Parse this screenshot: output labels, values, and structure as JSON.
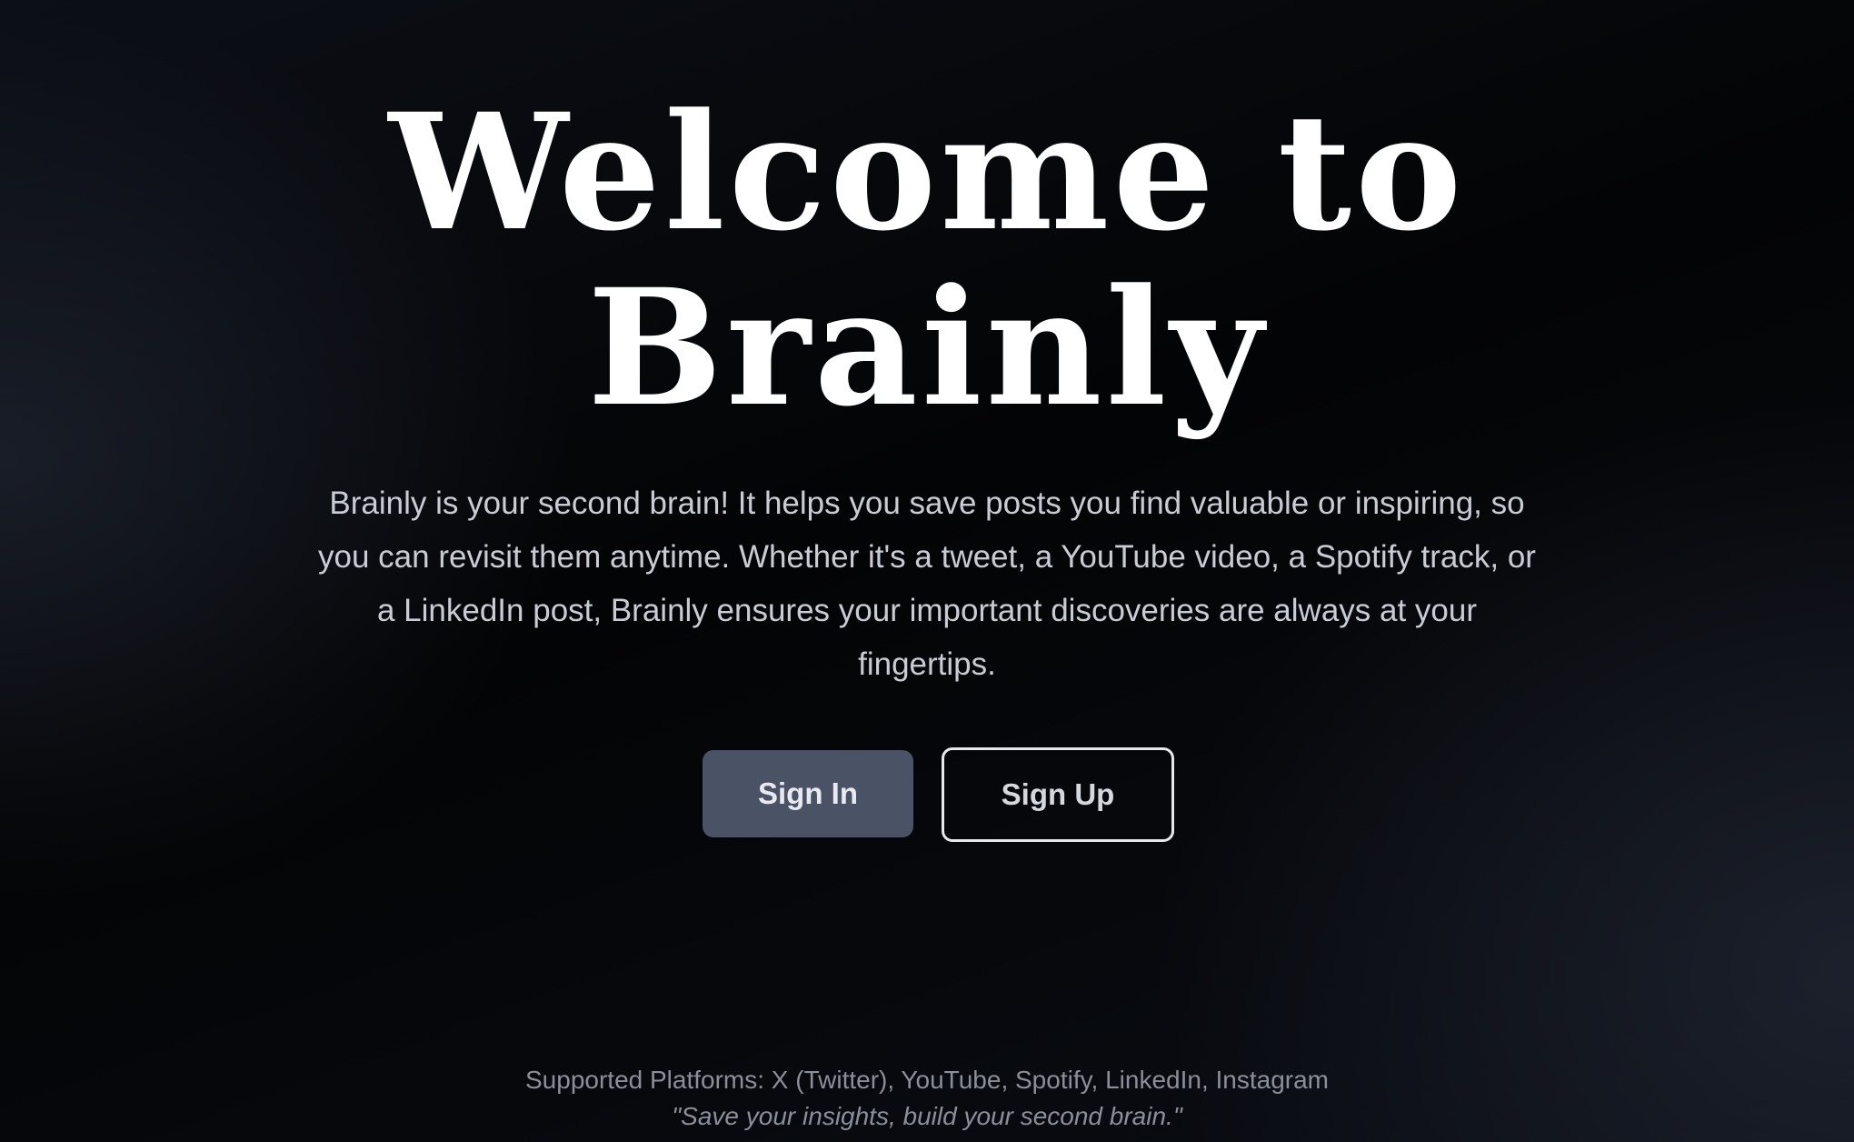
{
  "hero": {
    "title_line_1": "Welcome to",
    "title_line_2": "Brainly",
    "description": "Brainly is your second brain! It helps you save posts you find valuable or inspiring, so you can revisit them anytime. Whether it's a tweet, a YouTube video, a Spotify track, or a LinkedIn post, Brainly ensures your important discoveries are always at your fingertips."
  },
  "actions": {
    "sign_in_label": "Sign In",
    "sign_up_label": "Sign Up"
  },
  "footer": {
    "platforms": "Supported Platforms: X (Twitter), YouTube, Spotify, LinkedIn, Instagram",
    "tagline": "\"Save your insights, build your second brain.\""
  },
  "colors": {
    "background": "#030405",
    "sign_in_button": "#4a5266",
    "sign_up_border": "#e6e8ec",
    "description_text": "#c8ccd4",
    "footer_text": "#8a8f99"
  }
}
